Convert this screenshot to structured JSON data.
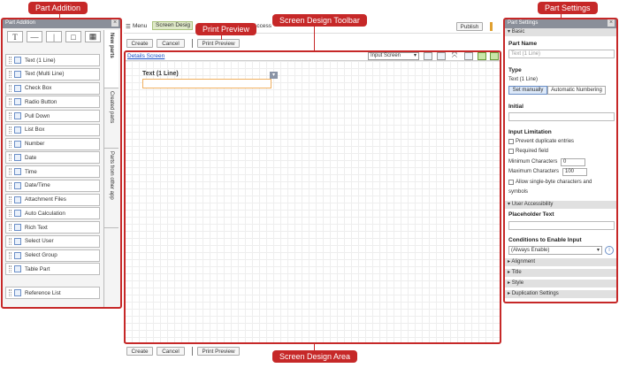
{
  "callouts": {
    "part_addition": "Part Addition",
    "print_preview": "Print Preview",
    "toolbar": "Screen Design Toolbar",
    "part_settings": "Part Settings",
    "design_area": "Screen Design Area"
  },
  "left_panel": {
    "title": "Part Addition",
    "tabs": [
      "New parts",
      "Created parts",
      "Parts from other app"
    ],
    "parts": [
      "Text (1 Line)",
      "Text (Multi Line)",
      "Check Box",
      "Radio Button",
      "Pull Down",
      "List Box",
      "Number",
      "Date",
      "Time",
      "Date/Time",
      "Attachment Files",
      "Auto Calculation",
      "Rich Text",
      "Select User",
      "Select Group",
      "Table Part"
    ],
    "reference": "Reference List"
  },
  "top": {
    "menu": "Menu",
    "screen_design": "Screen Desig",
    "access": "Access",
    "publish": "Publish"
  },
  "buttons": {
    "create": "Create",
    "cancel": "Cancel",
    "print_preview": "Print Preview"
  },
  "toolbar": {
    "details_link": "Details Screen",
    "screen_select": "Input Screen"
  },
  "canvas": {
    "field_label": "Text (1 Line)"
  },
  "right_panel": {
    "title": "Part Settings",
    "basic": "Basic",
    "part_name_label": "Part Name",
    "part_name_placeholder": "Text (1 Line)",
    "type_label": "Type",
    "type_value": "Text (1 Line)",
    "set_manually": "Set manually",
    "auto_numbering": "Automatic Numbering",
    "initial_label": "Initial",
    "input_limitation": "Input Limitation",
    "prevent_duplicates": "Prevent duplicate entries",
    "required": "Required field",
    "min_chars": "Minimum Characters",
    "min_value": "0",
    "max_chars": "Maximum Characters",
    "max_value": "100",
    "allow_single_byte": "Allow single-byte characters and",
    "symbols": "symbols",
    "user_accessibility": "User Accessibility",
    "placeholder_text": "Placeholder Text",
    "conditions_label": "Conditions to Enable Input",
    "conditions_value": "(Always Enable)",
    "sections": [
      "Alignment",
      "Title",
      "Style",
      "Duplication Settings"
    ]
  }
}
